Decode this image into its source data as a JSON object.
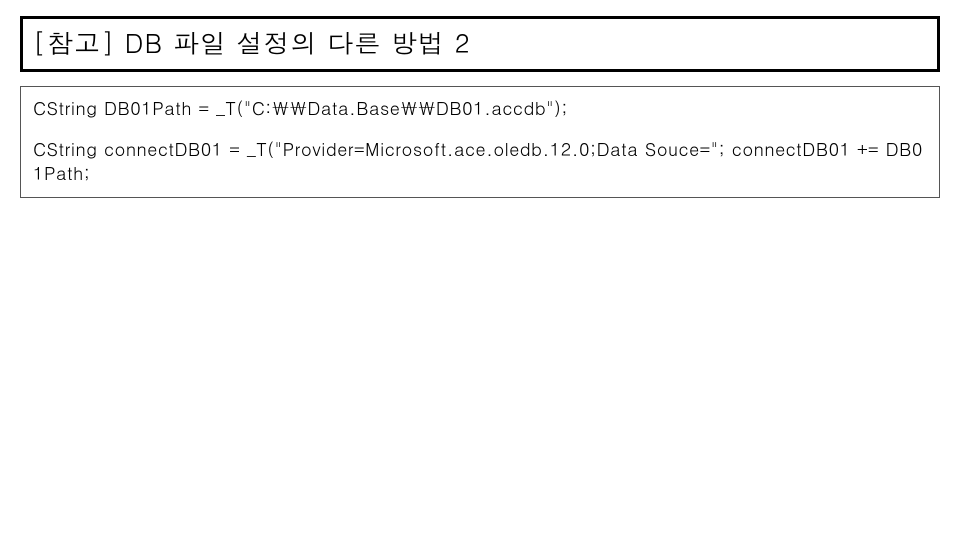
{
  "title": "[참고] DB 파일 설정의 다른 방법 2",
  "code": {
    "line1": "CString DB01Path = _T(\"C:\\\\Data.Base\\\\DB01.accdb\");",
    "line2": "CString connectDB01 = _T(\"Provider=Microsoft.ace.oledb.12.0;Data Souce=\"; connectDB01 += DB01Path;"
  }
}
